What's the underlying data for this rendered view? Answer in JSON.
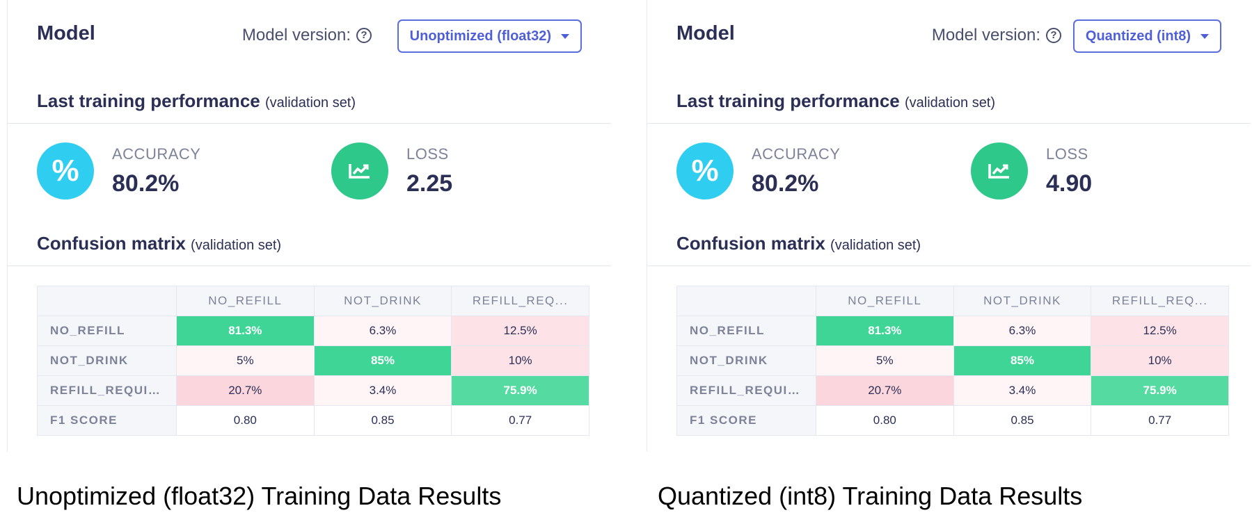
{
  "panels": [
    {
      "model_title": "Model",
      "version_label": "Model version:",
      "version_selected": "Unoptimized (float32)",
      "perf_title": "Last training performance",
      "perf_sub": "(validation set)",
      "accuracy_label": "ACCURACY",
      "accuracy_value": "80.2%",
      "loss_label": "LOSS",
      "loss_value": "2.25",
      "cm_title": "Confusion matrix",
      "cm_sub": "(validation set)",
      "cm": {
        "columns": [
          "NO_REFILL",
          "NOT_DRINK",
          "REFILL_REQ..."
        ],
        "rows": [
          {
            "label": "NO_REFILL",
            "values": [
              "81.3%",
              "6.3%",
              "12.5%"
            ]
          },
          {
            "label": "NOT_DRINK",
            "values": [
              "5%",
              "85%",
              "10%"
            ]
          },
          {
            "label": "REFILL_REQUIR...",
            "values": [
              "20.7%",
              "3.4%",
              "75.9%"
            ]
          },
          {
            "label": "F1 SCORE",
            "values": [
              "0.80",
              "0.85",
              "0.77"
            ]
          }
        ]
      },
      "caption": "Unoptimized (float32) Training Data Results"
    },
    {
      "model_title": "Model",
      "version_label": "Model version:",
      "version_selected": "Quantized (int8)",
      "perf_title": "Last training performance",
      "perf_sub": "(validation set)",
      "accuracy_label": "ACCURACY",
      "accuracy_value": "80.2%",
      "loss_label": "LOSS",
      "loss_value": "4.90",
      "cm_title": "Confusion matrix",
      "cm_sub": "(validation set)",
      "cm": {
        "columns": [
          "NO_REFILL",
          "NOT_DRINK",
          "REFILL_REQ..."
        ],
        "rows": [
          {
            "label": "NO_REFILL",
            "values": [
              "81.3%",
              "6.3%",
              "12.5%"
            ]
          },
          {
            "label": "NOT_DRINK",
            "values": [
              "5%",
              "85%",
              "10%"
            ]
          },
          {
            "label": "REFILL_REQUIR...",
            "values": [
              "20.7%",
              "3.4%",
              "75.9%"
            ]
          },
          {
            "label": "F1 SCORE",
            "values": [
              "0.80",
              "0.85",
              "0.77"
            ]
          }
        ]
      },
      "caption": "Quantized (int8) Training Data Results"
    }
  ],
  "icons": {
    "help": "question-circle-icon",
    "accuracy": "percent-icon",
    "loss": "trend-chart-icon",
    "dropdown": "caret-down-icon"
  },
  "colors": {
    "accent": "#4f5fd8",
    "accuracy_icon": "#2fcdf0",
    "loss_icon": "#2ec98a",
    "cm_high": "#3ed597",
    "cm_low": "#fcd6dd"
  }
}
